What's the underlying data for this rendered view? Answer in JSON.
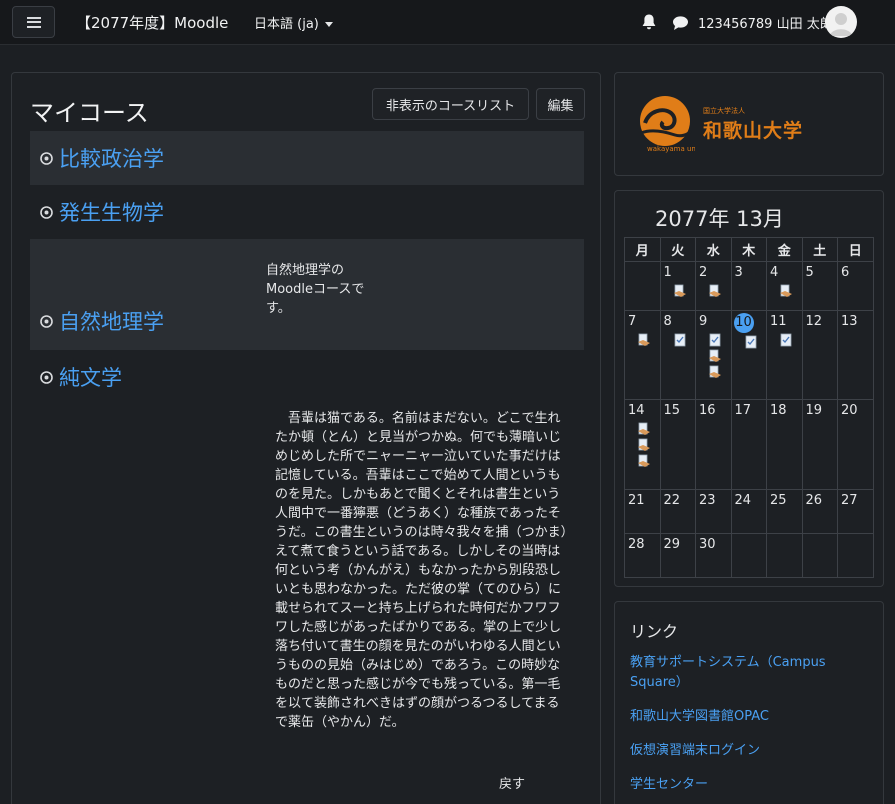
{
  "navbar": {
    "site_name": "【2077年度】Moodle",
    "language": "日本語 ‎(ja)‎",
    "user_name": "123456789 山田 太郎"
  },
  "main": {
    "title": "マイコース",
    "hidden_courses_button": "非表示のコースリスト",
    "edit_button": "編集",
    "courses": [
      {
        "name": "比較政治学",
        "summary": ""
      },
      {
        "name": "発生生物学",
        "summary": ""
      },
      {
        "name": "自然地理学",
        "summary": "自然地理学のMoodleコースです。"
      },
      {
        "name": "純文学",
        "summary": "吾輩は猫である。名前はまだない。どこで生れたか頓（とん）と見当がつかぬ。何でも薄暗いじめじめした所でニャーニャー泣いていた事だけは記憶している。吾輩はここで始めて人間というものを見た。しかもあとで聞くとそれは書生という人間中で一番獰悪（どうあく）な種族であったそうだ。この書生というのは時々我々を捕（つかま）えて煮て食うという話である。しかしその当時は何という考（かんがえ）もなかったから別段恐しいとも思わなかった。ただ彼の掌（てのひら）に載せられてスーと持ち上げられた時何だかフワフワした感じがあったばかりである。掌の上で少し落ち付いて書生の顔を見たのがいわゆる人間というものの見始（みはじめ）であろう。この時妙なものだと思った感じが今でも残っている。第一毛を以て装飾されべきはずの顔がつるつるしてまるで薬缶（やかん）だ。"
      }
    ],
    "back_label": "戻す"
  },
  "logo": {
    "small_text": "国立大学法人",
    "name": "和歌山大学",
    "romaji": "wakayama univ."
  },
  "calendar": {
    "title": "2077年 13月",
    "weekdays": [
      "月",
      "火",
      "水",
      "木",
      "金",
      "土",
      "日"
    ],
    "today": "10",
    "weeks": [
      [
        "",
        "1",
        "2",
        "3",
        "4",
        "5",
        "6"
      ],
      [
        "7",
        "8",
        "9",
        "10",
        "11",
        "12",
        "13"
      ],
      [
        "14",
        "15",
        "16",
        "17",
        "18",
        "19",
        "20"
      ],
      [
        "21",
        "22",
        "23",
        "24",
        "25",
        "26",
        "27"
      ],
      [
        "28",
        "29",
        "30",
        "",
        "",
        "",
        ""
      ]
    ]
  },
  "links": {
    "title": "リンク",
    "items": [
      "教育サポートシステム（Campus Square）",
      "和歌山大学図書館OPAC",
      "仮想演習端末ログイン",
      "学生センター"
    ]
  },
  "colors": {
    "link": "#4aa0f2",
    "brand_orange": "#e07d18",
    "background": "#1c1f23"
  }
}
